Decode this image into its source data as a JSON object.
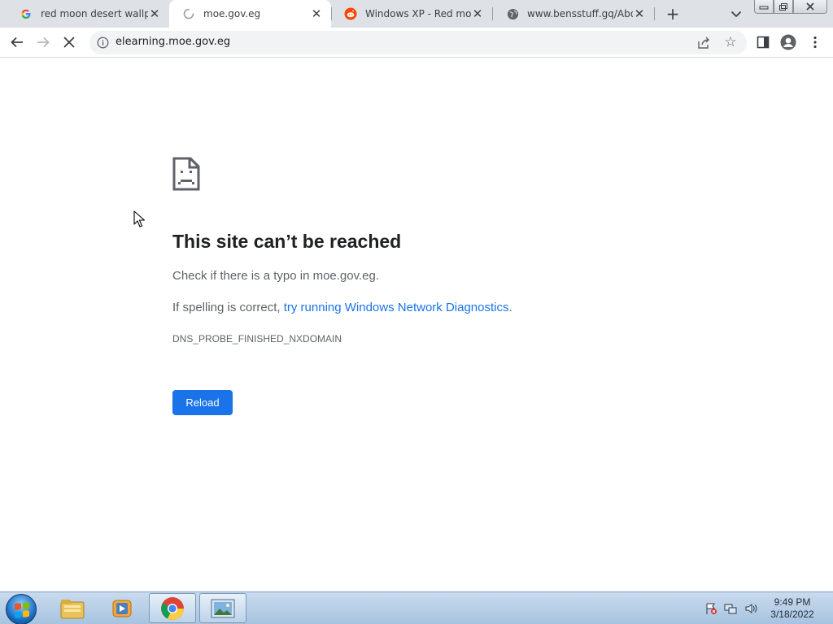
{
  "browser": {
    "tabs": [
      {
        "title": "red moon desert wallpaper",
        "favicon": "google-g-icon"
      },
      {
        "title": "moe.gov.eg",
        "favicon": "loading-spinner-icon",
        "active": true
      },
      {
        "title": "Windows XP - Red moon",
        "favicon": "reddit-icon"
      },
      {
        "title": "www.bensstuff.gq/About",
        "favicon": "globe-icon"
      }
    ],
    "url": "elearning.moe.gov.eg"
  },
  "error_page": {
    "heading": "This site can’t be reached",
    "check_text": "Check if there is a typo in moe.gov.eg.",
    "spelling_prefix": "If spelling is correct, ",
    "diagnostics_link": "try running Windows Network Diagnostics",
    "spelling_suffix": ".",
    "error_code": "DNS_PROBE_FINISHED_NXDOMAIN",
    "reload_label": "Reload"
  },
  "taskbar": {
    "apps": [
      "file-explorer-icon",
      "media-player-icon",
      "chrome-icon",
      "photo-viewer-icon"
    ],
    "time": "9:49 PM",
    "date": "3/18/2022"
  },
  "colors": {
    "accent": "#1a73e8",
    "heading": "#202124",
    "body_text": "#5f6368"
  }
}
